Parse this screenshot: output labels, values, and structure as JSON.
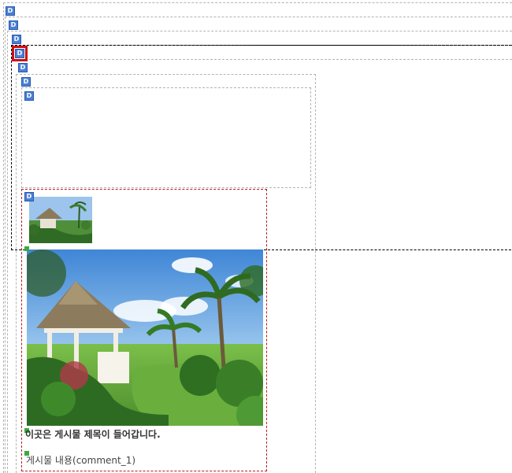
{
  "editor": {
    "marker_label": "D",
    "markers": [
      {
        "label": "D",
        "selected": false
      },
      {
        "label": "D",
        "selected": false
      },
      {
        "label": "D",
        "selected": false
      },
      {
        "label": "D",
        "selected": true
      },
      {
        "label": "D",
        "selected": false
      },
      {
        "label": "D",
        "selected": false
      },
      {
        "label": "D",
        "selected": false
      },
      {
        "label": "D",
        "selected": false
      }
    ]
  },
  "post": {
    "title": "이곳은 게시물 제목이 들어갑니다.",
    "content": "게시물 내용(comment_1)"
  },
  "colors": {
    "guide_gray": "#b4b4b4",
    "guide_black": "#000000",
    "guide_red": "#b41e1e",
    "marker_blue": "#4a7fd4",
    "selection_red": "#cc1111",
    "corner_green": "#3caa3c"
  }
}
